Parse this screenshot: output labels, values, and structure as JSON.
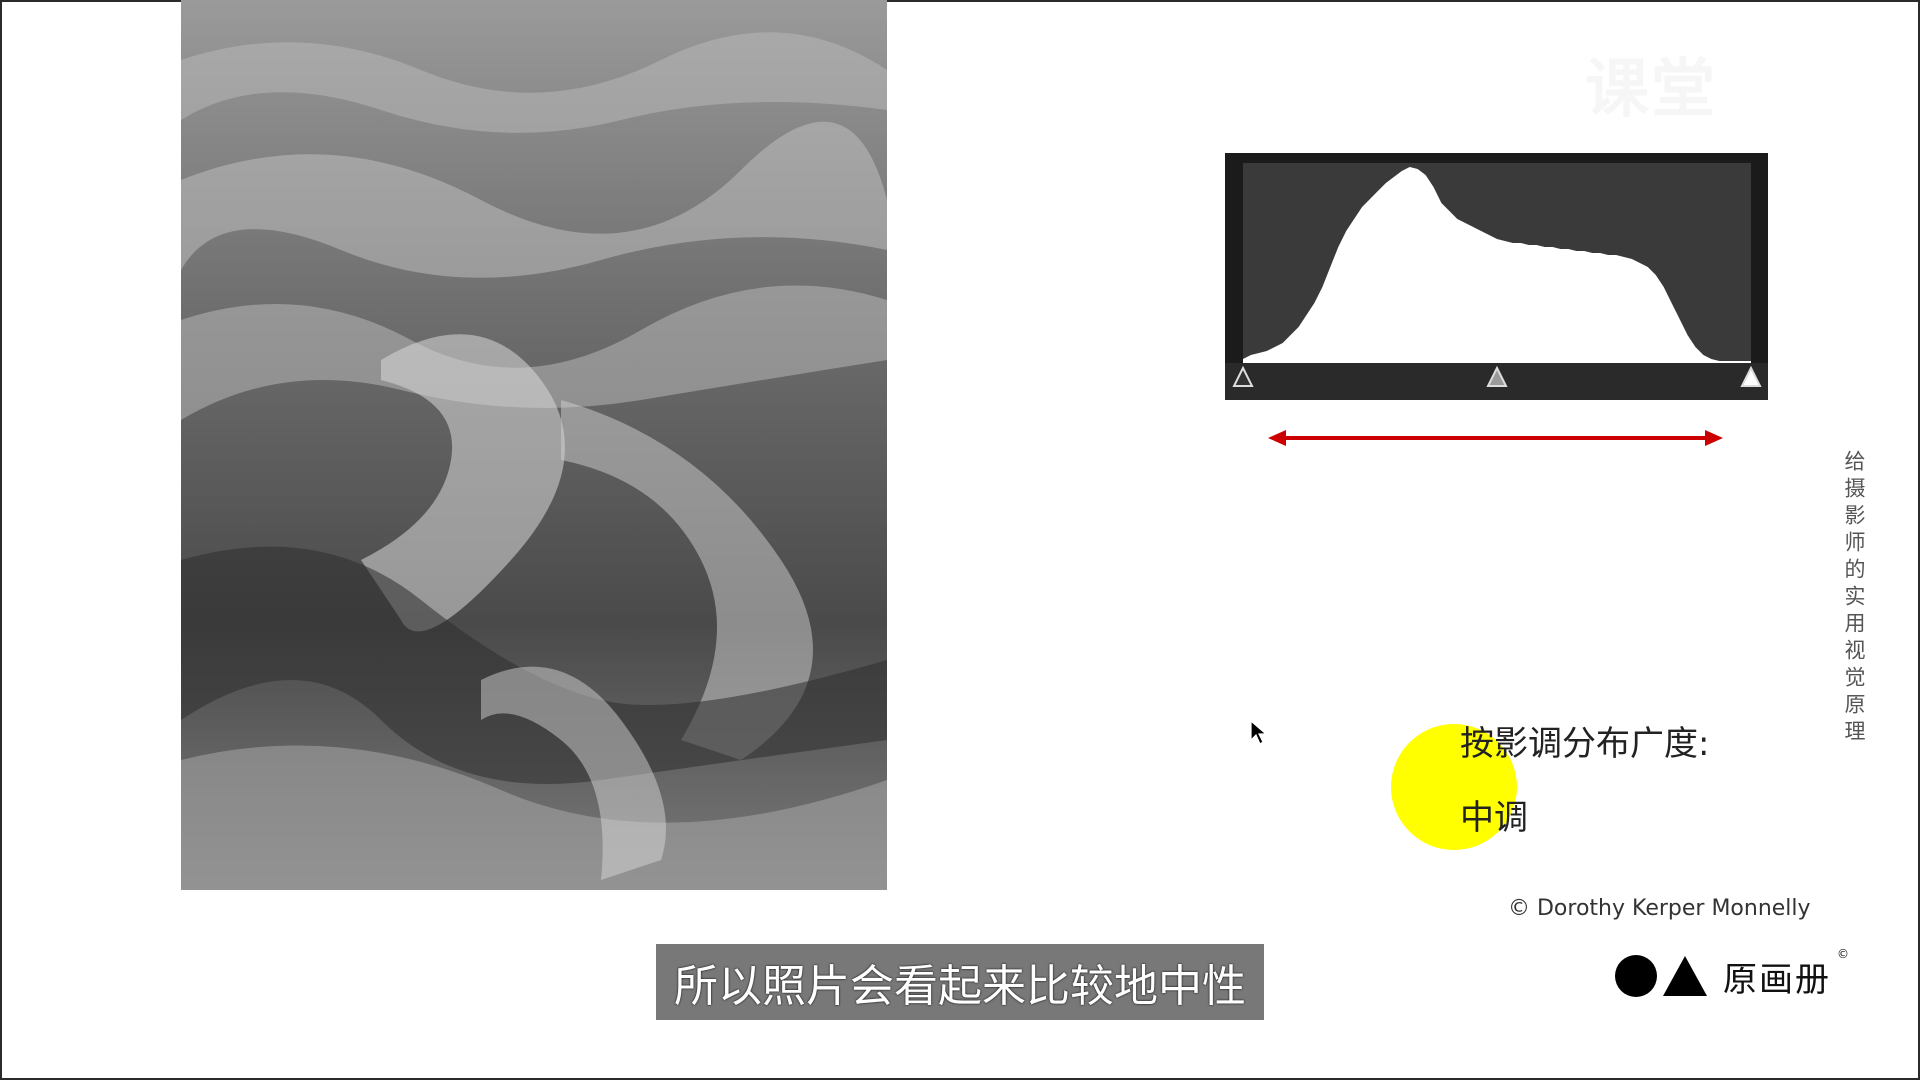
{
  "watermark": {
    "text": "课堂"
  },
  "side_caption": {
    "text": "给摄影师的实用视觉原理"
  },
  "tone_label": {
    "title": "按影调分布广度:",
    "value": "中调"
  },
  "credit": {
    "text": "© Dorothy Kerper Monnelly"
  },
  "logo": {
    "text": "原画册",
    "copyright": "©"
  },
  "subtitle": {
    "text": "所以照片会看起来比较地中性"
  },
  "histogram": {
    "levels": [
      2,
      4,
      5,
      6,
      8,
      10,
      14,
      18,
      24,
      30,
      38,
      48,
      58,
      66,
      72,
      78,
      82,
      86,
      90,
      93,
      96,
      98,
      97,
      94,
      88,
      80,
      76,
      72,
      70,
      68,
      66,
      64,
      62,
      61,
      60,
      60,
      59,
      59,
      58,
      58,
      57,
      57,
      56,
      56,
      55,
      55,
      54,
      54,
      53,
      52,
      50,
      48,
      44,
      38,
      30,
      22,
      14,
      8,
      4,
      2,
      1,
      1,
      1,
      1,
      1
    ],
    "shadow_slider": 0,
    "midtone_slider": 0.5,
    "highlight_slider": 1
  },
  "colors": {
    "histogram_bg": "#1b1b1b",
    "histogram_plot_bg": "#3a3a3a",
    "histogram_fill": "#ffffff",
    "arrow": "#cc0000",
    "dot": "#ffff00",
    "subtitle_bg": "#606060"
  }
}
